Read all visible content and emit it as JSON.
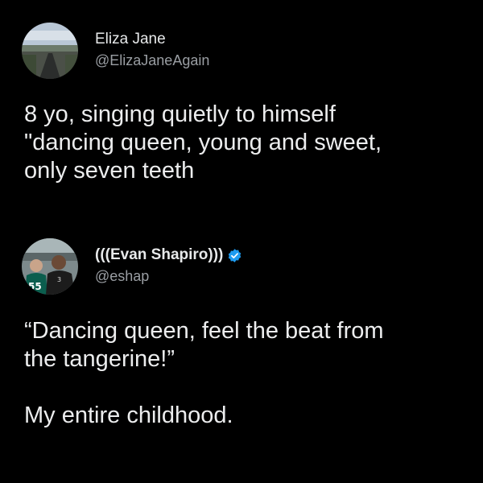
{
  "tweets": [
    {
      "display_name": "Eliza Jane",
      "handle": "@ElizaJaneAgain",
      "avatar_icon": "landscape-road-photo",
      "text_lines": [
        "8 yo, singing quietly to himself",
        "\"dancing queen, young and sweet,",
        "only seven teeth"
      ]
    },
    {
      "display_name": "(((Evan Shapiro)))",
      "handle": "@eshap",
      "avatar_icon": "people-in-jerseys-photo",
      "verified_icon": "verified-badge-icon",
      "verified_color": "#1d9bf0",
      "text_lines": [
        "“Dancing queen, feel the beat from",
        "the tangerine!”",
        "",
        "My entire childhood."
      ]
    }
  ]
}
